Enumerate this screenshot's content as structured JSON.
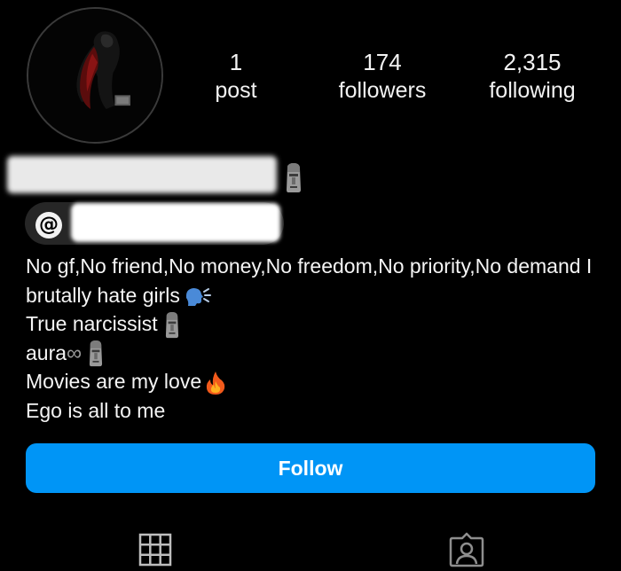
{
  "profile": {
    "avatar_icon": "thor-silhouette-avatar",
    "stats": {
      "posts": {
        "value": "1",
        "label": "post"
      },
      "followers": {
        "value": "174",
        "label": "followers"
      },
      "following": {
        "value": "2,315",
        "label": "following"
      }
    },
    "name_icon": "moai-emoji",
    "threads_icon": "threads-icon",
    "threads_glyph": "@"
  },
  "bio": {
    "line1_text": "No gf,No friend,No money,No freedom,No priority,No demand I brutally hate girls",
    "line1_emoji": "speaking-head-emoji",
    "line2_text": "True narcissist",
    "line2_emoji": "moai-emoji",
    "line3_text": "aura",
    "line3_symbol": "∞",
    "line3_emoji": "moai-emoji",
    "line4_text": "Movies are my love",
    "line4_emoji": "fire-emoji",
    "line5_text": "Ego is all to me"
  },
  "actions": {
    "follow_label": "Follow"
  },
  "tabs": {
    "grid_icon": "grid-icon",
    "tagged_icon": "tagged-person-icon"
  },
  "colors": {
    "background": "#000000",
    "accent": "#0095f6",
    "text": "#f5f5f5",
    "pill": "#262626"
  }
}
